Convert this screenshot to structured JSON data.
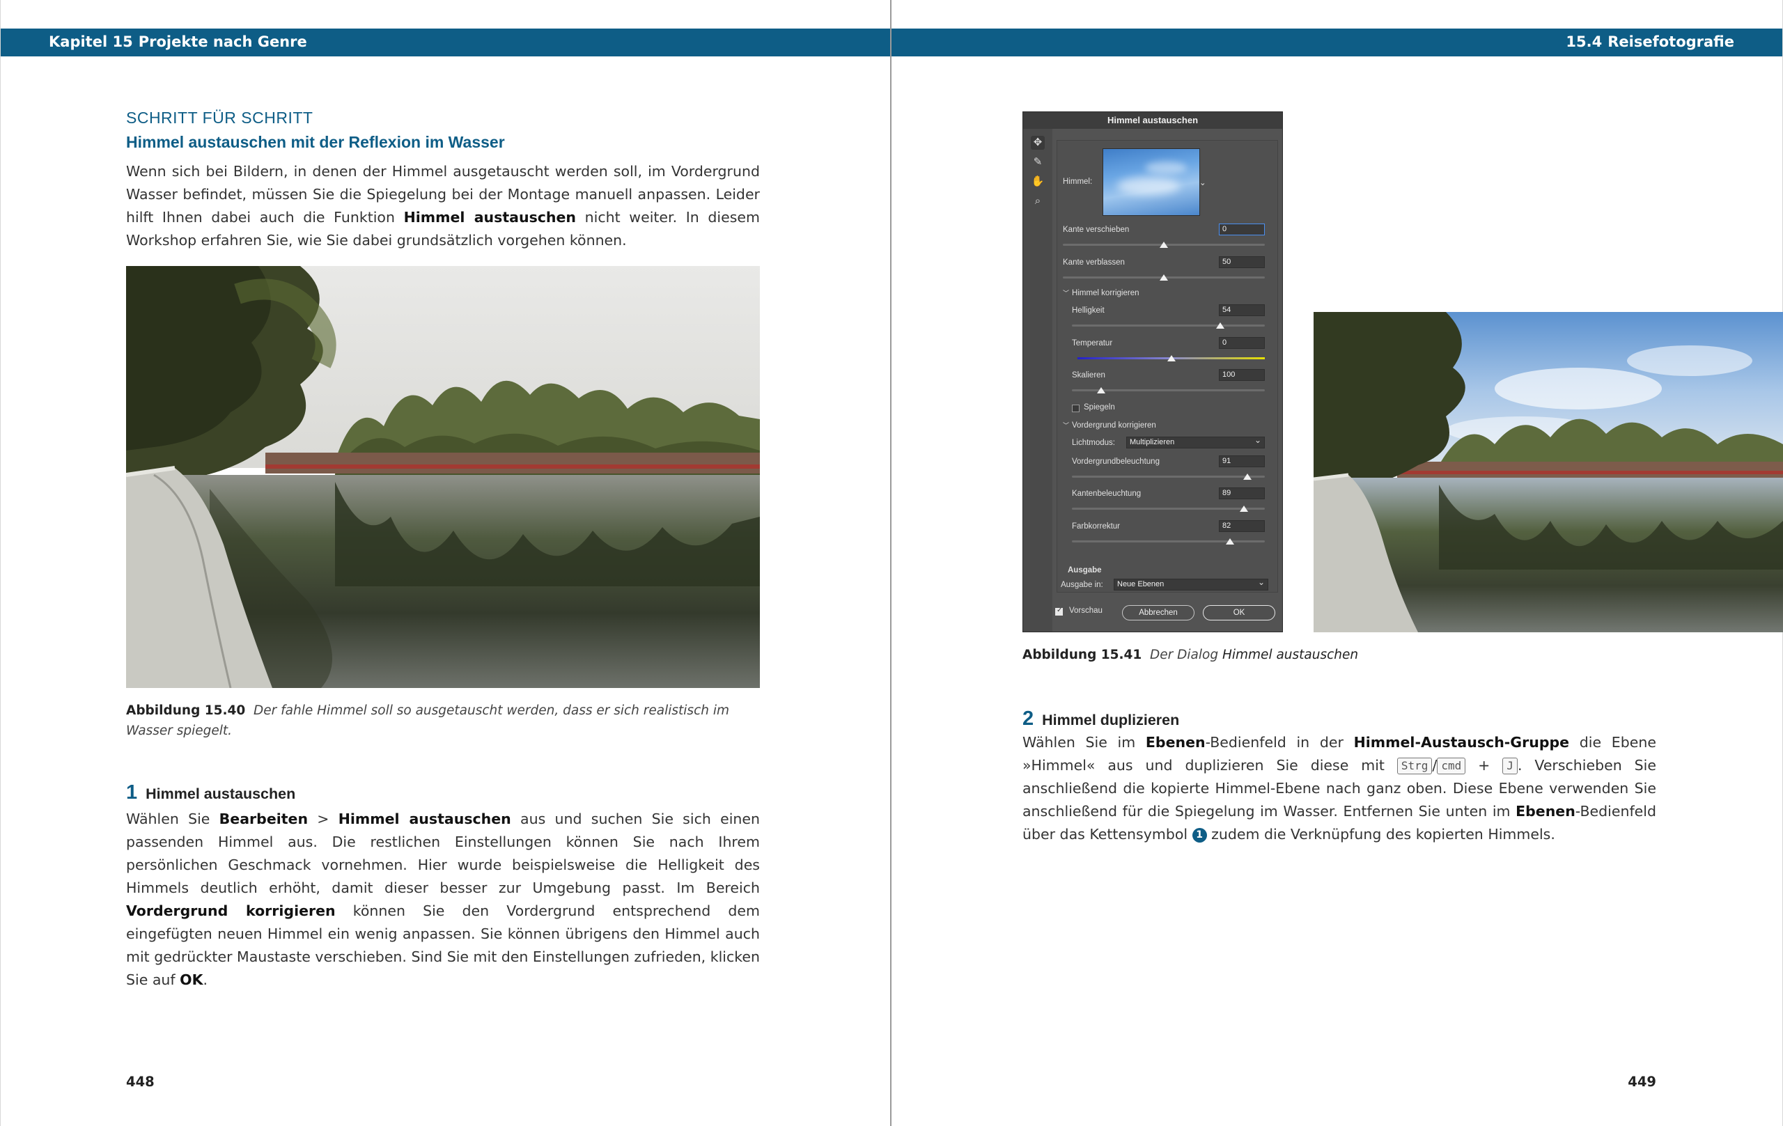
{
  "header": {
    "left_chapter": "Kapitel 15",
    "left_title": "Projekte nach Genre",
    "right_section": "15.4",
    "right_title": "Reisefotografie"
  },
  "left_page": {
    "kicker": "SCHRITT FÜR SCHRITT",
    "title": "Himmel austauschen mit der Reflexion im Wasser",
    "intro_1": "Wenn sich bei Bildern, in denen der Himmel ausgetauscht werden soll, im Vordergrund Wasser befindet, müssen Sie die Spiegelung bei der Montage manuell anpassen. Leider hilft Ihnen dabei auch die Funktion ",
    "intro_bold": "Himmel austauschen",
    "intro_2": " nicht weiter. In diesem Workshop erfahren Sie, wie Sie dabei grundsätzlich vorgehen können.",
    "figure_caption_num": "Abbildung 15.40",
    "figure_caption_text": "Der fahle Himmel soll so ausgetauscht werden, dass er sich realistisch im Wasser spiegelt.",
    "step1": {
      "number": "1",
      "title": "Himmel austauschen",
      "t1": "Wählen Sie ",
      "b1": "Bearbeiten",
      "t2": " > ",
      "b2": "Himmel austauschen",
      "t3": " aus und suchen Sie sich einen passenden Himmel aus. Die restlichen Einstellungen können Sie nach Ihrem persönlichen Geschmack vornehmen. Hier wurde beispielsweise die Helligkeit des Himmels deutlich erhöht, damit dieser besser zur Umgebung passt. Im Bereich ",
      "b3": "Vordergrund korrigieren",
      "t4": " können Sie den Vordergrund entsprechend dem eingefügten neuen Himmel ein wenig anpassen. Sie können übrigens den Himmel auch mit gedrückter Maustaste verschieben. Sind Sie mit den Einstellungen zufrieden, klicken Sie auf ",
      "b4": "OK",
      "t5": "."
    },
    "page_number": "448"
  },
  "right_page": {
    "figure_caption_num": "Abbildung 15.41",
    "figure_caption_pre": "Der Dialog ",
    "figure_caption_italic": "Himmel austauschen",
    "step2": {
      "number": "2",
      "title": "Himmel duplizieren",
      "t1": "Wählen Sie im ",
      "b1": "Ebenen",
      "t2": "-Bedienfeld in der ",
      "b2": "Himmel-Austausch-Gruppe",
      "t3": " die Ebene »Himmel« aus und duplizieren Sie diese mit ",
      "key1": "Strg",
      "slash": "/",
      "key2": "cmd",
      "plus": "+",
      "key3": "J",
      "t4": ". Verschieben Sie anschließend die kopierte Himmel-Ebene nach ganz oben. Diese Ebene verwenden Sie anschließend für die Spiegelung im Wasser. Entfernen Sie unten im ",
      "b3": "Ebenen",
      "t5": "-Bedienfeld über das Kettensymbol ",
      "badge": "1",
      "t6": " zudem die Verknüpfung des kopierten Himmels."
    },
    "page_number": "449"
  },
  "dialog": {
    "title": "Himmel austauschen",
    "sky_label": "Himmel:",
    "kante_verschieben": {
      "label": "Kante verschieben",
      "value": "0",
      "level": 0.5
    },
    "kante_verblassen": {
      "label": "Kante verblassen",
      "value": "50",
      "level": 0.5
    },
    "himmel_korrigieren": "Himmel korrigieren",
    "helligkeit": {
      "label": "Helligkeit",
      "value": "54",
      "level": 0.77
    },
    "temperatur": {
      "label": "Temperatur",
      "value": "0",
      "level": 0.5
    },
    "skalieren": {
      "label": "Skalieren",
      "value": "100",
      "level": 0.15
    },
    "spiegeln": "Spiegeln",
    "vordergrund_korrigieren": "Vordergrund korrigieren",
    "lichtmodus_label": "Lichtmodus:",
    "lichtmodus_value": "Multiplizieren",
    "vordergrundbeleuchtung": {
      "label": "Vordergrundbeleuchtung",
      "value": "91",
      "level": 0.91
    },
    "kantenbeleuchtung": {
      "label": "Kantenbeleuchtung",
      "value": "89",
      "level": 0.89
    },
    "farbkorrektur": {
      "label": "Farbkorrektur",
      "value": "82",
      "level": 0.82
    },
    "ausgabe": "Ausgabe",
    "ausgabe_in_label": "Ausgabe in:",
    "ausgabe_in_value": "Neue Ebenen",
    "vorschau": "Vorschau",
    "cancel": "Abbrechen",
    "ok": "OK"
  }
}
